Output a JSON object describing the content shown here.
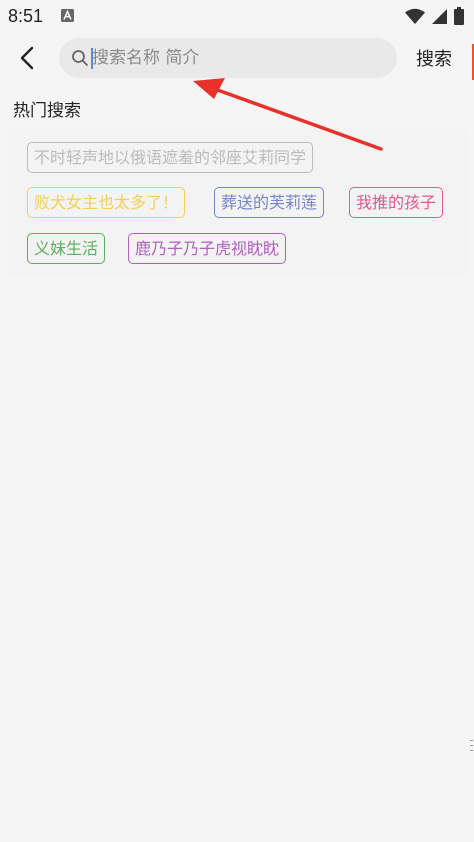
{
  "status_bar": {
    "time": "8:51",
    "notification_icon": "a-text-icon",
    "wifi_icon": "wifi-icon",
    "signal_icon": "signal-icon",
    "battery_icon": "battery-icon"
  },
  "toolbar": {
    "back_icon": "chevron-left-icon",
    "search": {
      "placeholder": "搜索名称 简介",
      "value": ""
    },
    "search_button_label": "搜索"
  },
  "hot_search": {
    "title": "热门搜索",
    "tags": [
      {
        "label": "不时轻声地以俄语遮羞的邻座艾莉同学",
        "color": "#bbbbbb"
      },
      {
        "label": "败犬女主也太多了！",
        "color": "#f3cf5a"
      },
      {
        "label": "葬送的芙莉莲",
        "color": "#7785c9"
      },
      {
        "label": "我推的孩子",
        "color": "#e25a8e"
      },
      {
        "label": "义妹生活",
        "color": "#5fae61"
      },
      {
        "label": "鹿乃子乃子虎视眈眈",
        "color": "#b45fc4"
      }
    ]
  },
  "colors": {
    "background": "#f5f5f5",
    "annotation_arrow": "#e8312a"
  }
}
